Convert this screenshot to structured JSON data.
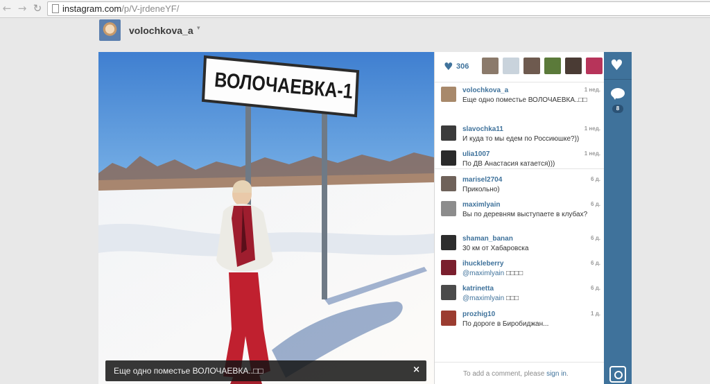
{
  "browser": {
    "url_host": "instagram.com",
    "url_path": "/p/V-jrdeneYF/"
  },
  "header": {
    "username": "volochkova_a",
    "caret": "▾"
  },
  "photo": {
    "sign_text": "ВОЛОЧАЕВКА-1",
    "caption": "Еще одно поместье ВОЛОЧАЕВКА..□□",
    "close": "×"
  },
  "likes": {
    "heart": "♥",
    "count": "306",
    "likers": [
      {
        "color": "#8b7a6b"
      },
      {
        "color": "#c9d3dc"
      },
      {
        "color": "#6e5a4f"
      },
      {
        "color": "#5b7a3a"
      },
      {
        "color": "#4a3b34"
      },
      {
        "color": "#b7345a"
      }
    ]
  },
  "comments": [
    {
      "user": "volochkova_a",
      "time": "1 нед.",
      "text": "Еще одно поместье ВОЛОЧАЕВКА..□□",
      "color": "#a8896b"
    },
    {
      "user": "slavochka11",
      "time": "1 нед.",
      "text": "И куда то мы едем по Россиюшке?))",
      "color": "#3b3b3b"
    },
    {
      "user": "ulia1007",
      "time": "1 нед.",
      "text": "По ДВ Анастасия катается)))",
      "color": "#2a2a2a"
    },
    {
      "user": "marisel2704",
      "time": "6 д.",
      "text": "Прикольно)",
      "color": "#6f625a"
    },
    {
      "user": "maximlyain",
      "time": "6 д.",
      "text": "Вы по деревням выступаете в клубах?",
      "color": "#8c8c8c"
    },
    {
      "user": "shaman_banan",
      "time": "6 д.",
      "text": "30 км от Хабаровска",
      "color": "#2d2d2d"
    },
    {
      "user": "ihuckleberry",
      "time": "6 д.",
      "mention": "@maximlyain",
      "text": " □□□□",
      "color": "#7a1f2e"
    },
    {
      "user": "katrinetta",
      "time": "6 д.",
      "mention": "@maximlyain",
      "text": " □□□",
      "color": "#4b4b4b"
    },
    {
      "user": "prozhig10",
      "time": "1 д.",
      "text": "По дороге в Биробиджан...",
      "color": "#9b3c30"
    }
  ],
  "add_comment": {
    "prefix": "To add a comment, please ",
    "link": "sign in",
    "suffix": "."
  },
  "actions": {
    "like_glyph": "♥",
    "comment_count": "8"
  }
}
